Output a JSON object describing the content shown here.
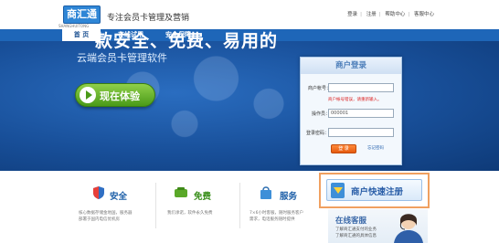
{
  "header": {
    "logo_text": "商汇通",
    "logo_sub": "SHANGHUITONG",
    "slogan": "专注会员卡管理及营销",
    "links": [
      "登录",
      "注册",
      "帮助中心",
      "客服中心"
    ]
  },
  "nav": {
    "items": [
      "首 页",
      "在线试用",
      "安全保障"
    ]
  },
  "hero": {
    "headline": "一款安全、免费、易用的",
    "subline": "云端会员卡管理软件",
    "try_button": "现在体验"
  },
  "login": {
    "title": "商户登录",
    "merchant_label": "商户帐号：",
    "merchant_value": "",
    "error_text": "商户帐号错误，请重新输入。",
    "operator_label": "操作员：",
    "operator_value": "000001",
    "password_label": "登录密码：",
    "password_value": "",
    "submit": "登 录",
    "forgot": "忘记密码"
  },
  "features": [
    {
      "title": "安全",
      "desc_line1": "核心数据存储金地国，服务器",
      "desc_line2": "部署于国内电信优机房",
      "color": "#1d5fa8"
    },
    {
      "title": "免费",
      "desc_line1": "我们承诺，软件永久免费",
      "desc_line2": "",
      "color": "#3a8f1c"
    },
    {
      "title": "服务",
      "desc_line1": "7×6小时客服，随时服务客户",
      "desc_line2": "需求，电话服务随时提供",
      "color": "#1d5fa8"
    }
  ],
  "register": {
    "label": "商户快速注册"
  },
  "support": {
    "title": "在线客服",
    "desc_line1": "了解商汇通支付的业务",
    "desc_line2": "了解商汇通的具体信息"
  }
}
